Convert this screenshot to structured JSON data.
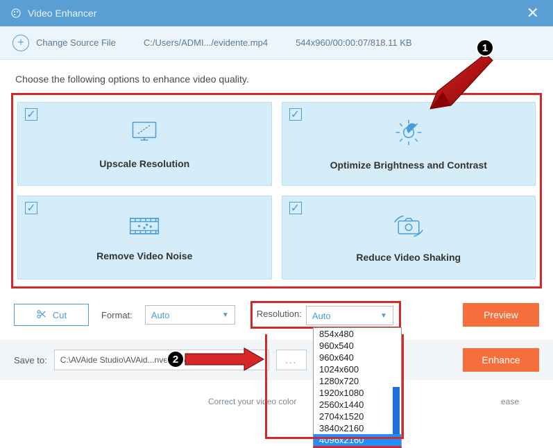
{
  "titlebar": {
    "title": "Video Enhancer"
  },
  "toolbar": {
    "change_source": "Change Source File",
    "file_path": "C:/Users/ADMI.../evidente.mp4",
    "file_meta": "544x960/00:00:07/818.11 KB"
  },
  "instruction": "Choose the following options to enhance video quality.",
  "options": [
    {
      "label": "Upscale Resolution"
    },
    {
      "label": "Optimize Brightness and Contrast"
    },
    {
      "label": "Remove Video Noise"
    },
    {
      "label": "Reduce Video Shaking"
    }
  ],
  "controls": {
    "cut": "Cut",
    "format_label": "Format:",
    "format_value": "Auto",
    "resolution_label": "Resolution:",
    "resolution_value": "Auto",
    "preview": "Preview",
    "enhance": "Enhance"
  },
  "resolution_options": [
    "854x480",
    "960x540",
    "960x640",
    "1024x600",
    "1280x720",
    "1920x1080",
    "2560x1440",
    "2704x1520",
    "3840x2160",
    "4096x2160"
  ],
  "resolution_selected": "4096x2160",
  "save": {
    "label": "Save to:",
    "path": "C:\\AVAide Studio\\AVAid...nverter\\Video Enhance",
    "browse": "..."
  },
  "bottom": {
    "left": "Correct your video color",
    "right": "ease"
  },
  "annotations": {
    "badge1": "1",
    "badge2": "2"
  }
}
